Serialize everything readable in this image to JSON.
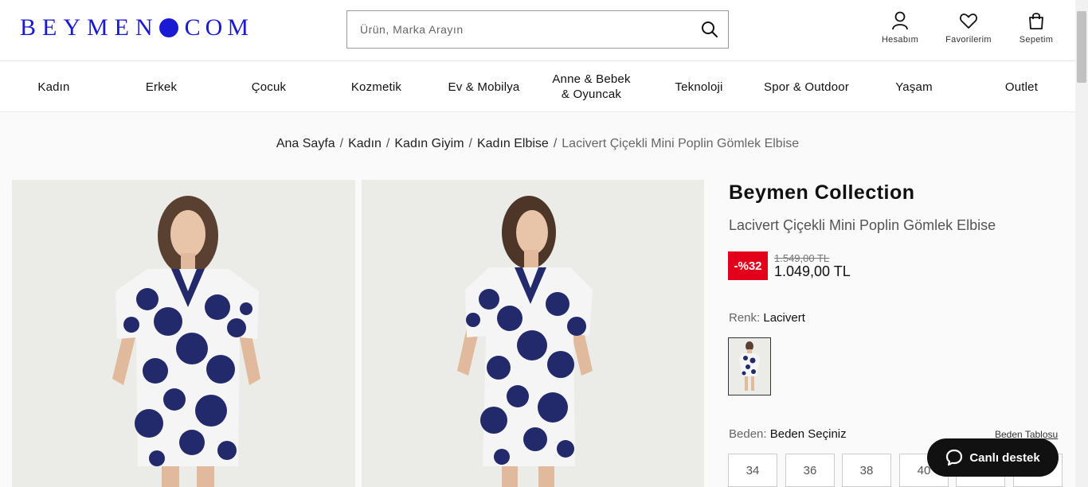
{
  "header": {
    "logo_left": "BEYMEN",
    "logo_right": "COM",
    "search": {
      "placeholder": "Ürün, Marka Arayın"
    },
    "actions": [
      {
        "label": "Hesabım",
        "icon": "user-icon"
      },
      {
        "label": "Favorilerim",
        "icon": "heart-icon"
      },
      {
        "label": "Sepetim",
        "icon": "bag-icon"
      }
    ]
  },
  "nav": {
    "items": [
      {
        "label": "Kadın"
      },
      {
        "label": "Erkek"
      },
      {
        "label": "Çocuk"
      },
      {
        "label": "Kozmetik"
      },
      {
        "label": "Ev & Mobilya"
      },
      {
        "label": "Anne & Bebek\n& Oyuncak"
      },
      {
        "label": "Teknoloji"
      },
      {
        "label": "Spor & Outdoor"
      },
      {
        "label": "Yaşam"
      },
      {
        "label": "Outlet"
      }
    ]
  },
  "breadcrumb": {
    "items": [
      "Ana Sayfa",
      "Kadın",
      "Kadın Giyim",
      "Kadın Elbise"
    ],
    "current": "Lacivert Çiçekli Mini Poplin Gömlek Elbise",
    "separator": "/"
  },
  "product": {
    "brand": "Beymen Collection",
    "name": "Lacivert Çiçekli Mini Poplin Gömlek Elbise",
    "discount_badge": "-%32",
    "old_price": "1.549,00 TL",
    "price": "1.049,00 TL",
    "color_label": "Renk:",
    "color_value": "Lacivert",
    "size_label": "Beden:",
    "size_value": "Beden Seçiniz",
    "size_table_link": "Beden Tablosu",
    "sizes": [
      "34",
      "36",
      "38",
      "40"
    ]
  },
  "chat": {
    "label": "Canlı destek",
    "icon": "chat-bubble-icon"
  },
  "colors": {
    "brand_blue": "#1a1ad4",
    "discount_red": "#e3001b",
    "dress_navy": "#232a6b"
  }
}
